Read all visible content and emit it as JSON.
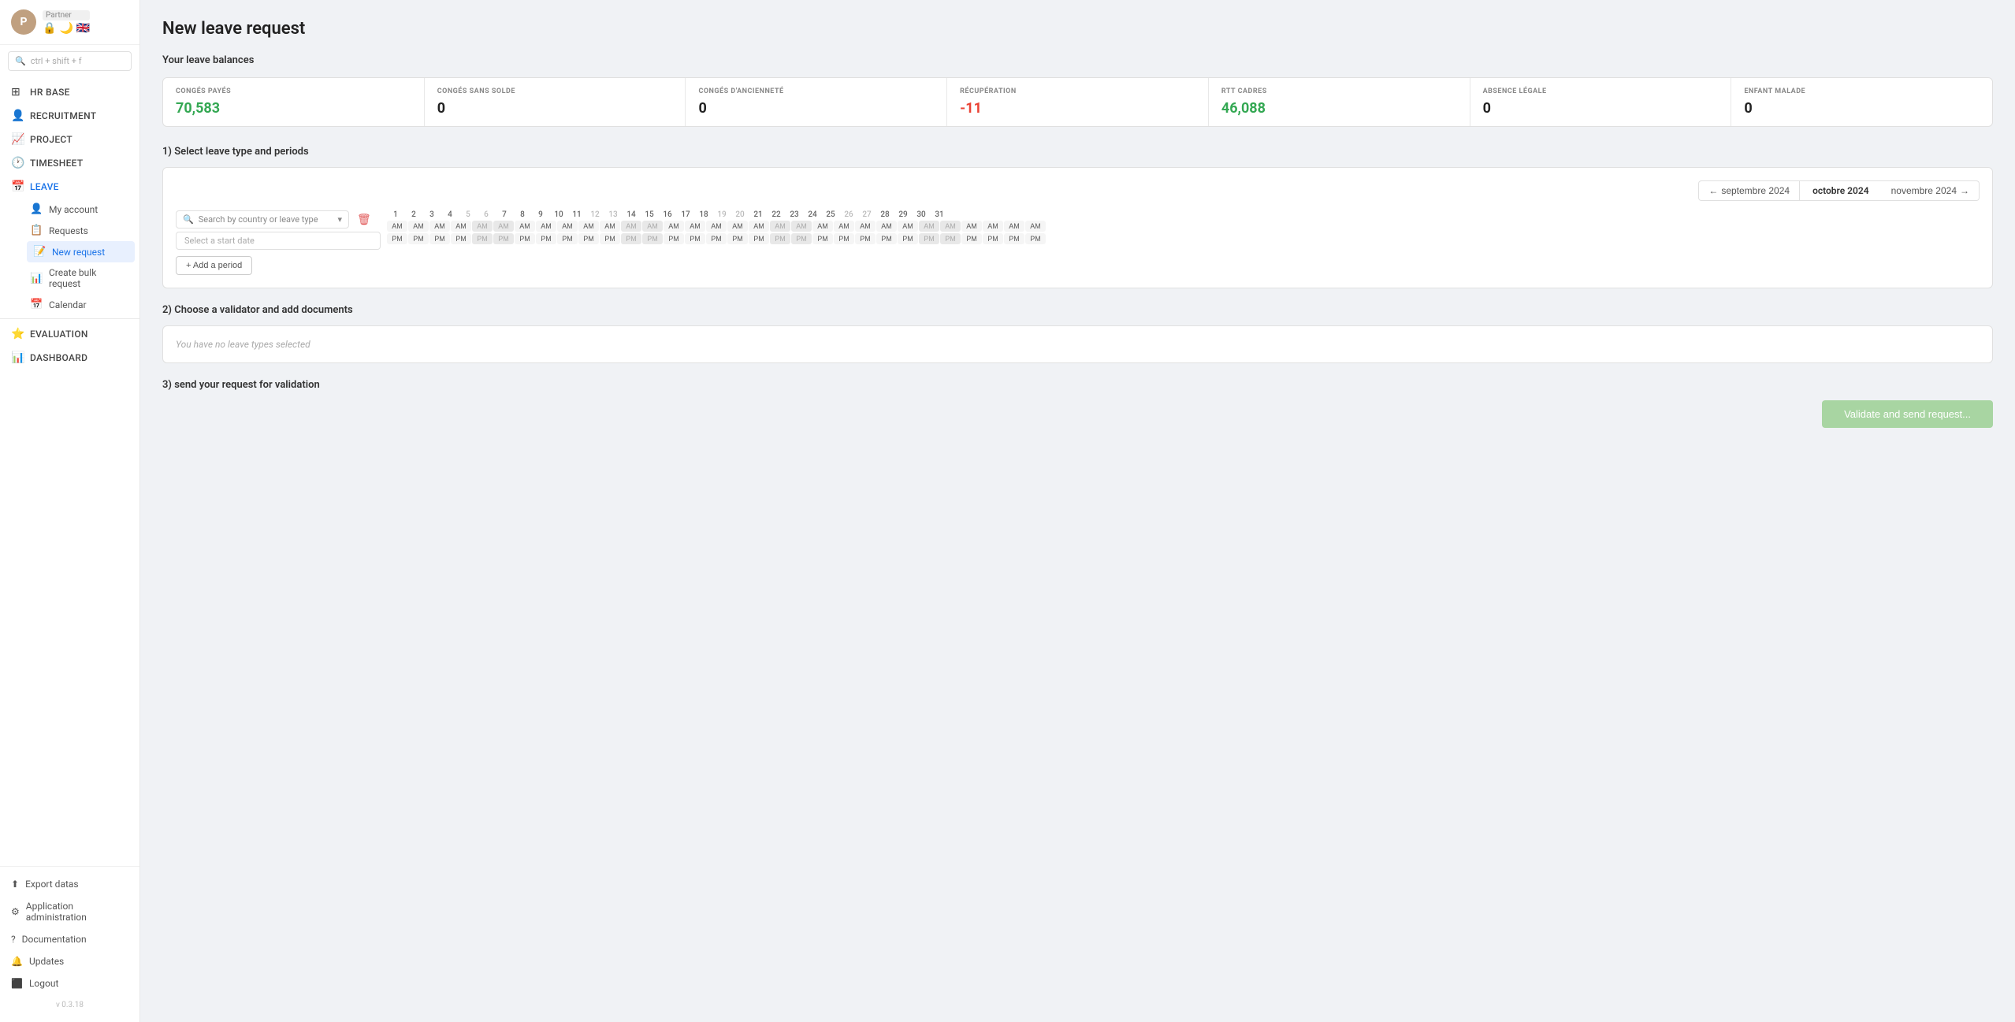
{
  "sidebar": {
    "user": {
      "avatar_letter": "P",
      "partner_label": "Partner"
    },
    "search_placeholder": "ctrl + shift + f",
    "nav": [
      {
        "id": "hr-base",
        "label": "HR BASE",
        "icon": "⊞"
      },
      {
        "id": "recruitment",
        "label": "RECRUITMENT",
        "icon": "👤"
      },
      {
        "id": "project",
        "label": "PROJECT",
        "icon": "📈"
      },
      {
        "id": "timesheet",
        "label": "TIMESHEET",
        "icon": "🕐"
      },
      {
        "id": "leave",
        "label": "LEAVE",
        "icon": "📅",
        "active": true
      }
    ],
    "leave_sub": [
      {
        "id": "my-account",
        "label": "My account",
        "icon": "👤"
      },
      {
        "id": "requests",
        "label": "Requests",
        "icon": "📋"
      },
      {
        "id": "new-request",
        "label": "New request",
        "icon": "📝",
        "active": true
      },
      {
        "id": "create-bulk",
        "label": "Create bulk request",
        "icon": "📊"
      },
      {
        "id": "calendar",
        "label": "Calendar",
        "icon": "📅"
      }
    ],
    "bottom_items": [
      {
        "id": "evaluation",
        "label": "EVALUATION",
        "icon": "⭐"
      },
      {
        "id": "dashboard",
        "label": "DASHBOARD",
        "icon": "📊"
      },
      {
        "id": "export-datas",
        "label": "Export datas",
        "icon": "⬆"
      },
      {
        "id": "app-admin",
        "label": "Application administration",
        "icon": "⚙"
      },
      {
        "id": "documentation",
        "label": "Documentation",
        "icon": "?"
      },
      {
        "id": "updates",
        "label": "Updates",
        "icon": "🔔"
      },
      {
        "id": "logout",
        "label": "Logout",
        "icon": "⬛"
      }
    ],
    "version": "v 0.3.18"
  },
  "page": {
    "title": "New leave request",
    "balances_title": "Your leave balances",
    "balances": [
      {
        "id": "conges-payes",
        "label": "CONGÉS PAYÉS",
        "value": "70,583",
        "color": "green"
      },
      {
        "id": "conges-sans-solde",
        "label": "CONGÉS SANS SOLDE",
        "value": "0",
        "color": "black"
      },
      {
        "id": "conges-anciennete",
        "label": "CONGÉS D'ANCIENNETÉ",
        "value": "0",
        "color": "black"
      },
      {
        "id": "recuperation",
        "label": "RÉCUPÉRATION",
        "value": "-11",
        "color": "red"
      },
      {
        "id": "rtt-cadres",
        "label": "RTT CADRES",
        "value": "46,088",
        "color": "green"
      },
      {
        "id": "absence-legale",
        "label": "ABSENCE LÉGALE",
        "value": "0",
        "color": "black"
      },
      {
        "id": "enfant-malade",
        "label": "ENFANT MALADE",
        "value": "0",
        "color": "black"
      }
    ],
    "step1_label": "1) Select leave type and periods",
    "step2_label": "2) Choose a validator and add documents",
    "step3_label": "3) send your request for validation",
    "calendar": {
      "prev_month": "septembre 2024",
      "current_month": "octobre 2024",
      "next_month": "novembre 2024",
      "days": [
        1,
        2,
        3,
        4,
        5,
        6,
        7,
        8,
        9,
        10,
        11,
        12,
        13,
        14,
        15,
        16,
        17,
        18,
        19,
        20,
        21,
        22,
        23,
        24,
        25,
        26,
        27,
        28,
        29,
        30,
        31
      ],
      "weekends": [
        5,
        6,
        12,
        13,
        19,
        20,
        26,
        27
      ],
      "search_placeholder": "Search by country or leave type",
      "start_date_placeholder": "Select a start date",
      "add_period_label": "+ Add a period"
    },
    "no_leave_msg": "You have no leave types selected",
    "validate_btn": "Validate and send request..."
  }
}
